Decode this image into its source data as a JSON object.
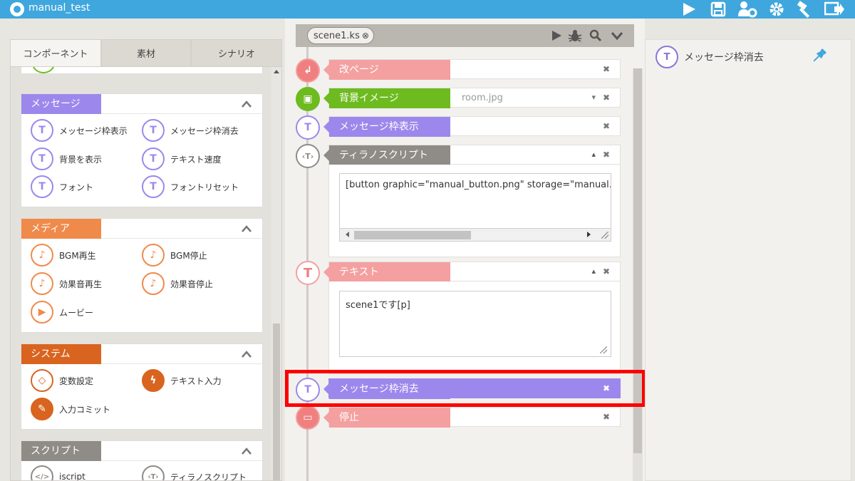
{
  "app": {
    "title": "manual_test"
  },
  "colors": {
    "topbar": "#3fa7dd",
    "message": "#9c88ec",
    "media": "#f08a4b",
    "system": "#d9641f",
    "script": "#8f8b86",
    "kaipage": "#f4a0a0",
    "bg_image": "#6dbb1f",
    "highlight": "#ff0000"
  },
  "toolbar": {
    "icons": [
      "play-icon",
      "save-icon",
      "users-gear-icon",
      "gear-icon",
      "hammer-icon",
      "export-icon"
    ]
  },
  "left": {
    "tabs": [
      "コンポーネント",
      "素材",
      "シナリオ"
    ],
    "active_tab": "コンポーネント",
    "sections": [
      {
        "label": "メッセージ",
        "items": [
          {
            "label": "メッセージ枠表示",
            "glyph": "T"
          },
          {
            "label": "メッセージ枠消去",
            "glyph": "T"
          },
          {
            "label": "背景を表示",
            "glyph": "T"
          },
          {
            "label": "テキスト速度",
            "glyph": "T"
          },
          {
            "label": "フォント",
            "glyph": "T"
          },
          {
            "label": "フォントリセット",
            "glyph": "T"
          }
        ]
      },
      {
        "label": "メディア",
        "items": [
          {
            "label": "BGM再生",
            "glyph": "♪"
          },
          {
            "label": "BGM停止",
            "glyph": "♪"
          },
          {
            "label": "効果音再生",
            "glyph": "♪"
          },
          {
            "label": "効果音停止",
            "glyph": "♪"
          },
          {
            "label": "ムービー",
            "glyph": "▶"
          }
        ]
      },
      {
        "label": "システム",
        "items": [
          {
            "label": "変数設定",
            "glyph": "◇"
          },
          {
            "label": "テキスト入力",
            "glyph": "ϟ"
          },
          {
            "label": "入力コミット",
            "glyph": "✎"
          }
        ]
      },
      {
        "label": "スクリプト",
        "items": [
          {
            "label": "iscript",
            "glyph": "</>"
          },
          {
            "label": "ティラノスクリプト",
            "glyph": "‹T›"
          }
        ]
      }
    ]
  },
  "editor": {
    "file_tab": "scene1.ks",
    "file_tab_close": "⊗",
    "tags": [
      {
        "label": "改ページ",
        "glyph": "↲"
      },
      {
        "label": "背景イメージ",
        "glyph": "▣",
        "value": "room.jpg"
      },
      {
        "label": "メッセージ枠表示",
        "glyph": "T"
      },
      {
        "label": "ティラノスクリプト",
        "glyph": "‹T›",
        "code": "[button graphic=\"manual_button.png\" storage=\"manual.ks\" r"
      },
      {
        "label": "テキスト",
        "glyph": "T",
        "code": "scene1です[p]"
      },
      {
        "label": "メッセージ枠消去",
        "glyph": "T"
      },
      {
        "label": "停止",
        "glyph": "▭"
      }
    ],
    "close_glyph": "✖"
  },
  "right": {
    "title": "メッセージ枠消去",
    "glyph": "T"
  }
}
